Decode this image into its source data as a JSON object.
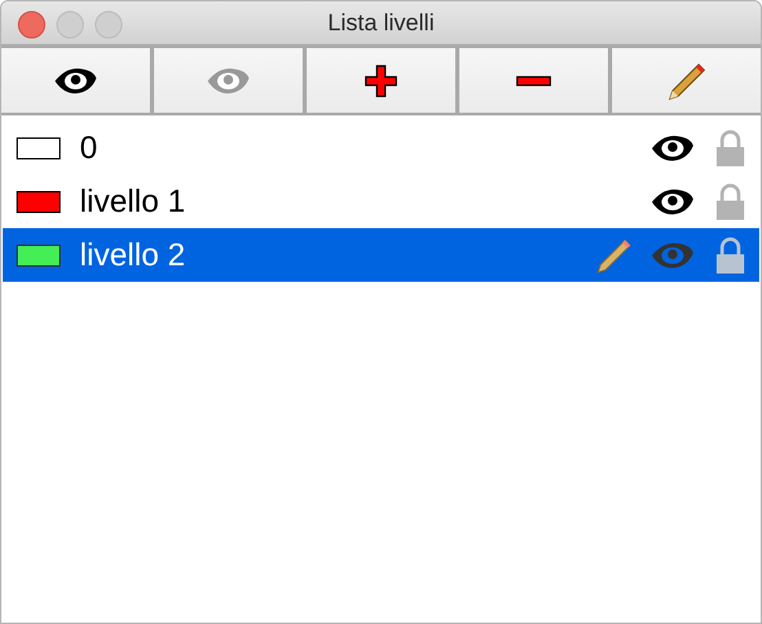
{
  "window": {
    "title": "Lista livelli"
  },
  "toolbar": [
    {
      "kind": "eye"
    },
    {
      "kind": "eye-dim"
    },
    {
      "kind": "plus"
    },
    {
      "kind": "minus"
    },
    {
      "kind": "pencil"
    }
  ],
  "layers": [
    {
      "name": "0",
      "color": "#ffffff",
      "selected": false,
      "current": false,
      "visible": true
    },
    {
      "name": "livello 1",
      "color": "#ff0000",
      "selected": false,
      "current": false,
      "visible": true
    },
    {
      "name": "livello 2",
      "color": "#44ee55",
      "selected": true,
      "current": true,
      "visible": true
    }
  ]
}
